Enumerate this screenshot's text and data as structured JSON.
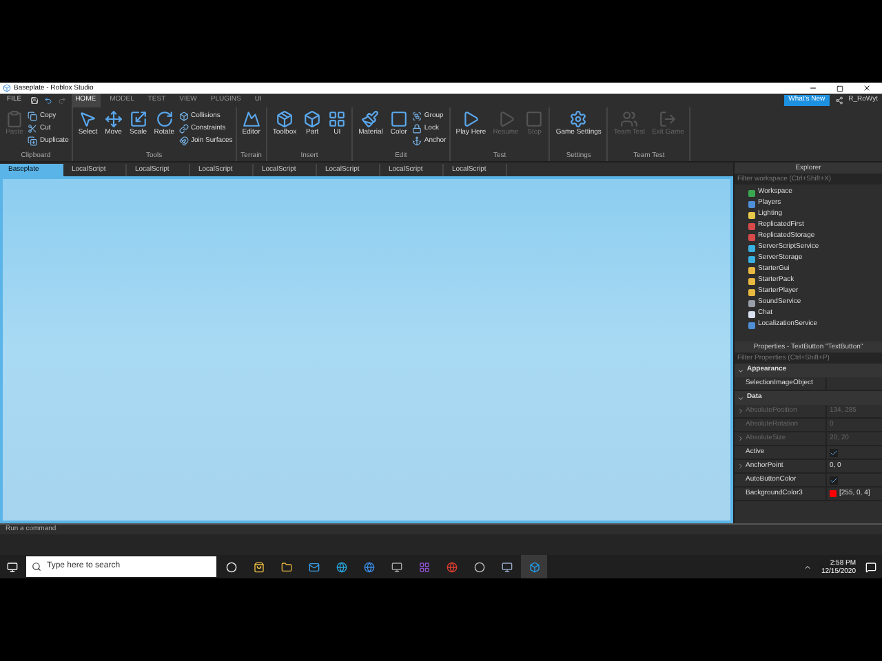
{
  "window": {
    "title": "Baseplate - Roblox Studio"
  },
  "menu_tabs": [
    {
      "label": "FILE",
      "selected": false
    },
    {
      "label": "HOME",
      "selected": true
    },
    {
      "label": "MODEL",
      "selected": false
    },
    {
      "label": "TEST",
      "selected": false
    },
    {
      "label": "VIEW",
      "selected": false
    },
    {
      "label": "PLUGINS",
      "selected": false
    },
    {
      "label": "UI",
      "selected": false
    }
  ],
  "account": {
    "whats_new": "What's New",
    "user": "R_RoWyt"
  },
  "ribbon": [
    {
      "label": "Clipboard",
      "tools": [
        {
          "label": "Paste",
          "kind": "large",
          "disabled": true
        },
        {
          "label": "Copy",
          "kind": "small",
          "disabled": false
        },
        {
          "label": "Cut",
          "kind": "small",
          "disabled": false
        },
        {
          "label": "Duplicate",
          "kind": "small",
          "disabled": false
        }
      ]
    },
    {
      "label": "Tools",
      "tools": [
        {
          "label": "Select",
          "kind": "large",
          "disabled": false
        },
        {
          "label": "Move",
          "kind": "large",
          "disabled": false
        },
        {
          "label": "Scale",
          "kind": "large",
          "disabled": false
        },
        {
          "label": "Rotate",
          "kind": "large",
          "disabled": false
        },
        {
          "label": "Collisions",
          "kind": "small",
          "disabled": false
        },
        {
          "label": "Constraints",
          "kind": "small",
          "disabled": false
        },
        {
          "label": "Join Surfaces",
          "kind": "small",
          "disabled": false
        }
      ]
    },
    {
      "label": "Terrain",
      "tools": [
        {
          "label": "Editor",
          "kind": "large",
          "disabled": false
        }
      ]
    },
    {
      "label": "Insert",
      "tools": [
        {
          "label": "Toolbox",
          "kind": "large",
          "disabled": false
        },
        {
          "label": "Part",
          "kind": "large",
          "disabled": false
        },
        {
          "label": "UI",
          "kind": "large",
          "disabled": false
        }
      ]
    },
    {
      "label": "Edit",
      "tools": [
        {
          "label": "Material",
          "kind": "large",
          "disabled": false
        },
        {
          "label": "Color",
          "kind": "large",
          "disabled": false
        },
        {
          "label": "Group",
          "kind": "small",
          "disabled": false
        },
        {
          "label": "Lock",
          "kind": "small",
          "disabled": false
        },
        {
          "label": "Anchor",
          "kind": "small",
          "disabled": false
        }
      ]
    },
    {
      "label": "Test",
      "tools": [
        {
          "label": "Play Here",
          "kind": "large",
          "disabled": false
        },
        {
          "label": "Resume",
          "kind": "large",
          "disabled": true
        },
        {
          "label": "Stop",
          "kind": "large",
          "disabled": true
        }
      ]
    },
    {
      "label": "Settings",
      "tools": [
        {
          "label": "Game Settings",
          "kind": "large",
          "disabled": false
        }
      ]
    },
    {
      "label": "Team Test",
      "tools": [
        {
          "label": "Team Test",
          "kind": "large",
          "disabled": true
        },
        {
          "label": "Exit Game",
          "kind": "large",
          "disabled": true
        }
      ]
    }
  ],
  "doc_tabs": [
    {
      "label": "Baseplate",
      "selected": true
    },
    {
      "label": "LocalScript",
      "selected": false
    },
    {
      "label": "LocalScript",
      "selected": false
    },
    {
      "label": "LocalScript",
      "selected": false
    },
    {
      "label": "LocalScript",
      "selected": false
    },
    {
      "label": "LocalScript",
      "selected": false
    },
    {
      "label": "LocalScript",
      "selected": false
    },
    {
      "label": "LocalScript",
      "selected": false
    }
  ],
  "explorer": {
    "title": "Explorer",
    "placeholder": "Filter workspace (Ctrl+Shift+X)",
    "items": [
      {
        "name": "Workspace",
        "color": "#3aa650"
      },
      {
        "name": "Players",
        "color": "#4f8fd8"
      },
      {
        "name": "Lighting",
        "color": "#e8c84a"
      },
      {
        "name": "ReplicatedFirst",
        "color": "#d84a4a"
      },
      {
        "name": "ReplicatedStorage",
        "color": "#d84a4a"
      },
      {
        "name": "ServerScriptService",
        "color": "#3ab0e0"
      },
      {
        "name": "ServerStorage",
        "color": "#3ab0e0"
      },
      {
        "name": "StarterGui",
        "color": "#e8b840"
      },
      {
        "name": "StarterPack",
        "color": "#e8b840"
      },
      {
        "name": "StarterPlayer",
        "color": "#e8b840"
      },
      {
        "name": "SoundService",
        "color": "#9aa0a8"
      },
      {
        "name": "Chat",
        "color": "#d8e0f0"
      },
      {
        "name": "LocalizationService",
        "color": "#4f8fd8"
      }
    ]
  },
  "properties": {
    "title": "Properties - TextButton \"TextButton\"",
    "placeholder": "Filter Properties (Ctrl+Shift+P)",
    "sections": [
      {
        "name": "Appearance",
        "expanded": true,
        "rows": [
          {
            "kind": "text",
            "name": "SelectionImageObject",
            "value": "",
            "disabled": false,
            "expandable": false
          }
        ]
      },
      {
        "name": "Data",
        "expanded": true,
        "rows": [
          {
            "kind": "text",
            "name": "AbsolutePosition",
            "value": "134, 285",
            "disabled": true,
            "expandable": true
          },
          {
            "kind": "text",
            "name": "AbsoluteRotation",
            "value": "0",
            "disabled": true,
            "expandable": false
          },
          {
            "kind": "text",
            "name": "AbsoluteSize",
            "value": "20, 20",
            "disabled": true,
            "expandable": true
          },
          {
            "kind": "check",
            "name": "Active",
            "checked": true,
            "disabled": false,
            "expandable": false
          },
          {
            "kind": "text",
            "name": "AnchorPoint",
            "value": "0, 0",
            "disabled": false,
            "expandable": true
          },
          {
            "kind": "check",
            "name": "AutoButtonColor",
            "checked": true,
            "disabled": false,
            "expandable": false
          },
          {
            "kind": "color",
            "name": "BackgroundColor3",
            "value": "[255, 0, 4]",
            "color": "#ff0004",
            "disabled": false,
            "expandable": false
          }
        ]
      }
    ]
  },
  "command_bar": {
    "placeholder": "Run a command"
  },
  "taskbar": {
    "search_placeholder": "Type here to search",
    "time": "2:58 PM",
    "date": "12/15/2020"
  }
}
